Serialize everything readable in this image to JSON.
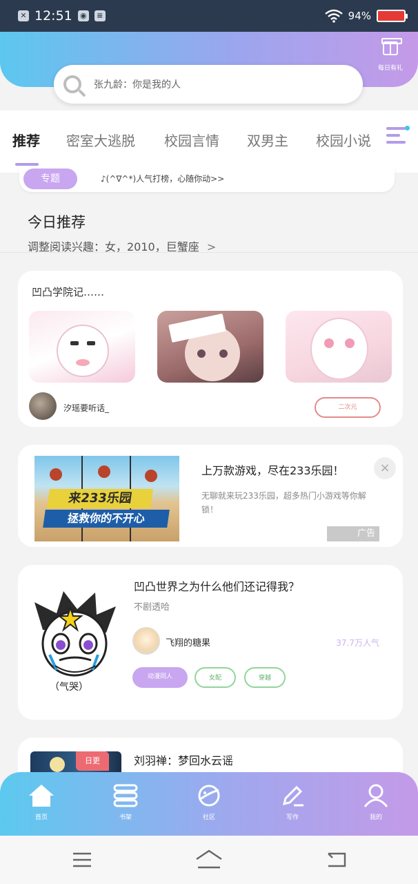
{
  "status_bar": {
    "time": "12:51",
    "battery": "94%"
  },
  "header": {
    "gift_label": "每日有礼",
    "search_placeholder": "张九龄：你是我的人"
  },
  "tabs": [
    "推荐",
    "密室大逃脱",
    "校园言情",
    "双男主",
    "校园小说"
  ],
  "topic": {
    "label": "专题",
    "text": "♪(^∇^*)人气打榜，心随你动>>"
  },
  "today": {
    "title": "今日推荐",
    "subtitle": "调整阅读兴趣：女，2010，巨蟹座",
    "chevron": ">"
  },
  "card1": {
    "title": "凹凸学院记……",
    "author": "汐瑶要听话_",
    "tag": "二次元"
  },
  "ad": {
    "image_text_1": "来233乐园",
    "image_text_2": "拯救你的不开心",
    "title": "上万款游戏，尽在233乐园！",
    "description": "无聊就来玩233乐园，超多热门小游戏等你解锁！",
    "badge": "广告",
    "close": "×"
  },
  "card3": {
    "title": "凹凸世界之为什么他们还记得我？",
    "subtitle": "不剧透哈",
    "author": "飞翔的糖果",
    "popularity": "37.7万人气",
    "art_caption": "（气哭）",
    "tags": [
      "动漫同人",
      "女配",
      "穿越"
    ]
  },
  "card4": {
    "title": "刘羽禅：梦回水云谣",
    "badge": "日更"
  },
  "bottom_nav": [
    {
      "label": "首页",
      "icon": "home-icon"
    },
    {
      "label": "书架",
      "icon": "bookshelf-icon"
    },
    {
      "label": "社区",
      "icon": "planet-icon"
    },
    {
      "label": "写作",
      "icon": "pen-icon"
    },
    {
      "label": "我的",
      "icon": "user-icon"
    }
  ],
  "colors": {
    "accent": "#b39be8",
    "gradient_start": "#5cc7ef",
    "gradient_end": "#c59ae8",
    "tag_red": "#e48a8a",
    "tag_green": "#5fb36b"
  }
}
